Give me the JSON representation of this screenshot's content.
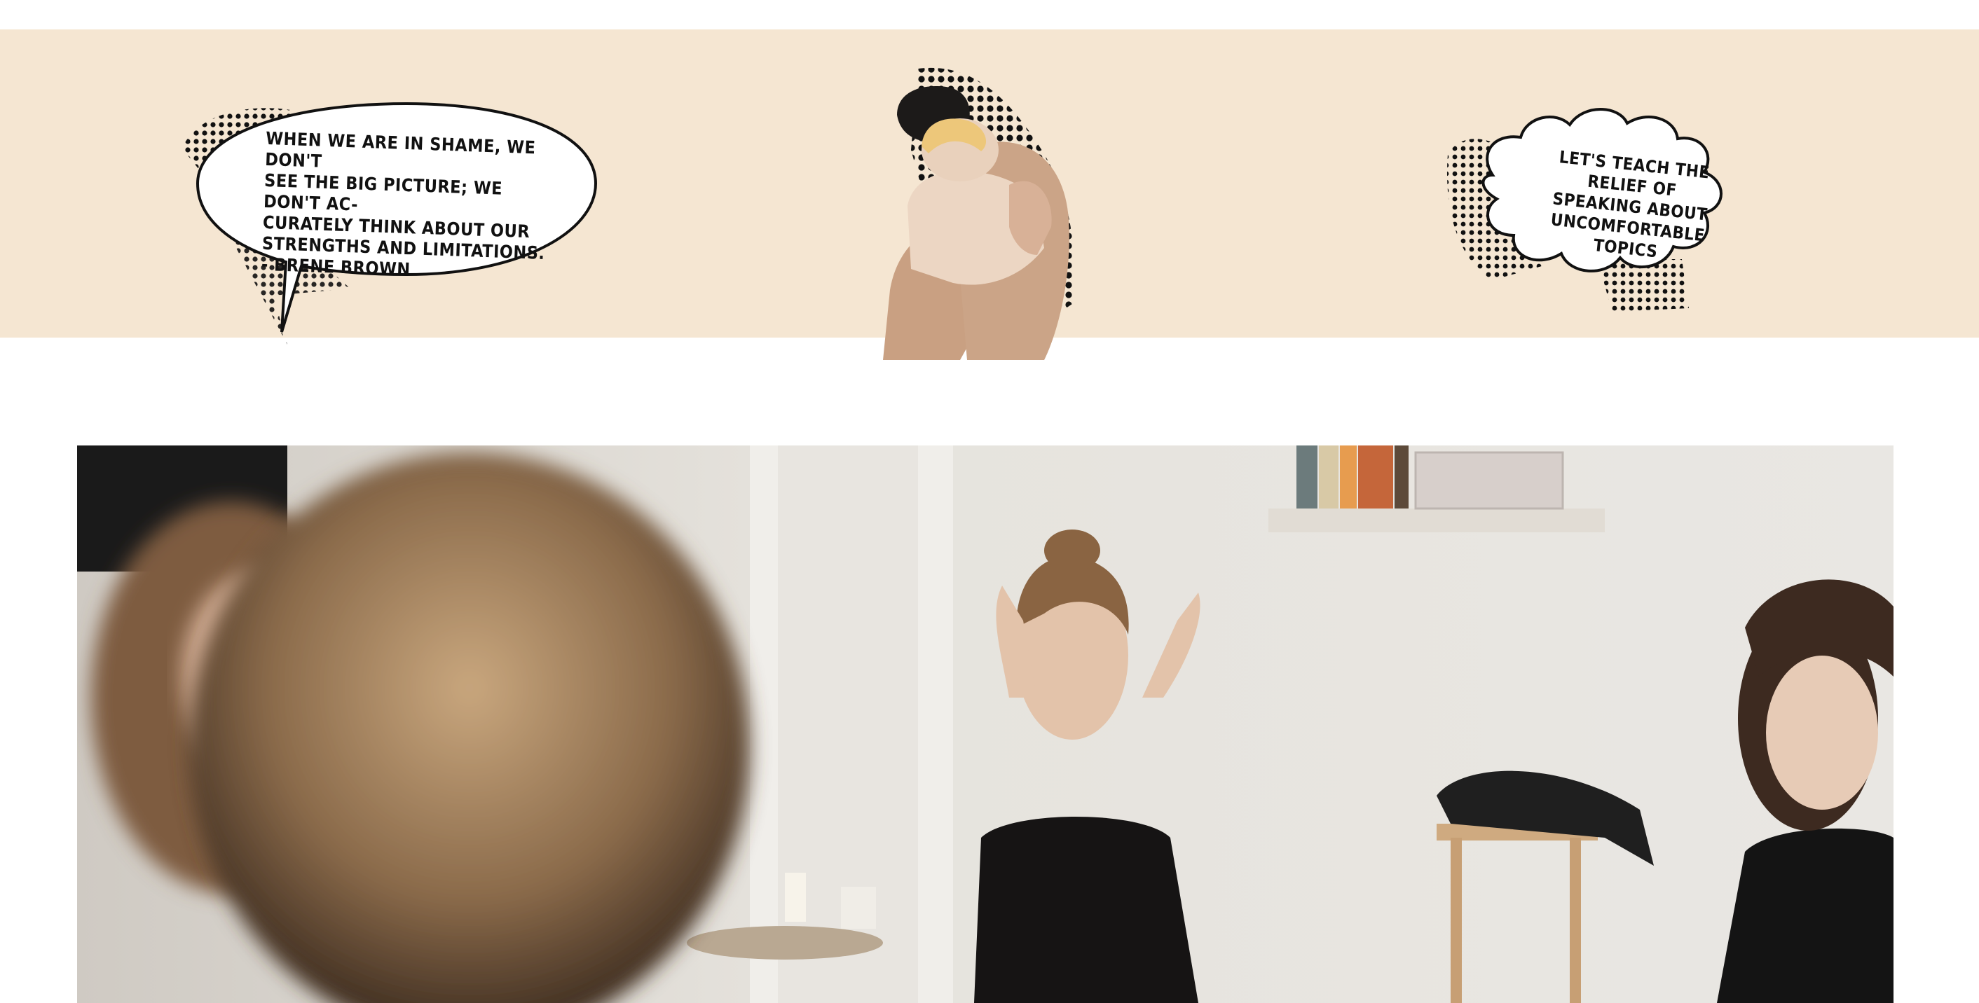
{
  "banner": {
    "color": "#f5e6d2",
    "quote_left": {
      "lines": [
        "WHEN WE ARE IN SHAME, WE DON'T",
        "SEE THE BIG PICTURE; WE DON'T AC-",
        "CURATELY THINK ABOUT OUR",
        "STRENGTHS AND LIMITATIONS.",
        " - BRENE BROWN"
      ]
    },
    "illustration": "hugging-couple-illustration",
    "quote_right": {
      "text": "LET'S TEACH THE RELIEF OF SPEAKING ABOUT UNCOMFORTABLE TOPICS"
    }
  },
  "photo": {
    "subject": "group-of-friends-photo"
  }
}
